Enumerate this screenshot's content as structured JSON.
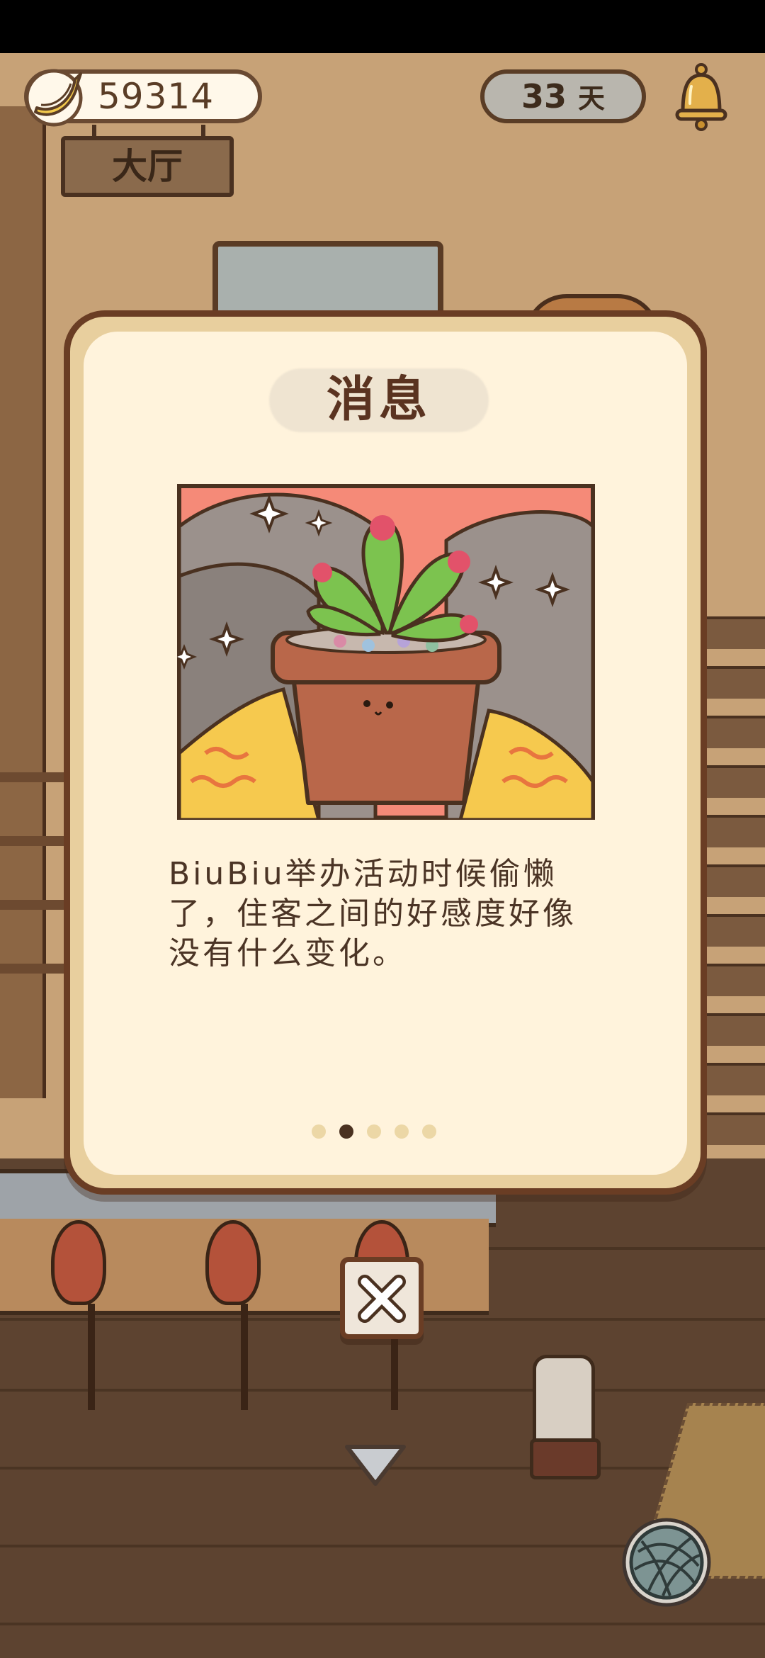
{
  "hud": {
    "coins": "59314",
    "days_value": "33",
    "days_unit": "天",
    "room_name": "大厅"
  },
  "dialog": {
    "title": "消息",
    "illustration": "potted-succulent-plant",
    "message": "BiuBiu举办活动时候偷懒了，住客之间的好感度好像没有什么变化。",
    "page_current": 2,
    "page_total": 5
  },
  "icons": {
    "coin": "banana-icon",
    "notifications": "bell-icon",
    "close": "close-icon",
    "scroll_down": "triangle-down-icon",
    "yarn": "yarn-ball-icon"
  },
  "colors": {
    "dialog_border": "#6a3d24",
    "dialog_bg": "#fff3dc",
    "dialog_frame": "#e8cf9e",
    "text": "#4b3425",
    "pager_active": "#4a3120",
    "pager_inactive": "#ecd7a6"
  }
}
